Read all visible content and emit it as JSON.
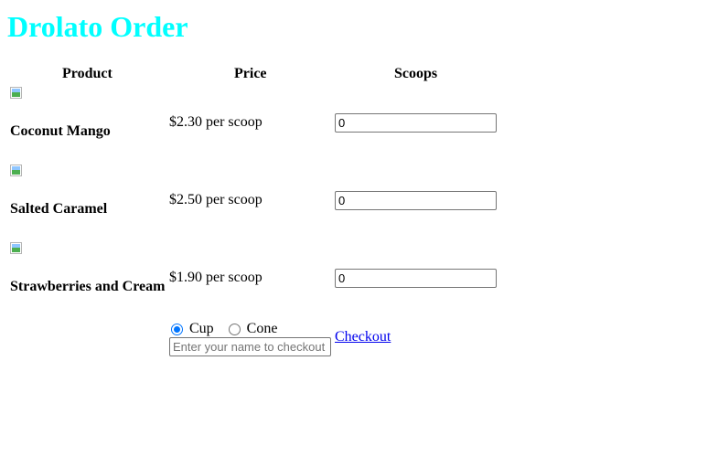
{
  "title": "Drolato Order",
  "table_headers": {
    "product": "Product",
    "price": "Price",
    "scoops": "Scoops"
  },
  "products": [
    {
      "name": "Coconut Mango",
      "price": "$2.30 per scoop",
      "scoops": "0"
    },
    {
      "name": "Salted Caramel",
      "price": "$2.50 per scoop",
      "scoops": "0"
    },
    {
      "name": "Strawberries and Cream",
      "price": "$1.90 per scoop",
      "scoops": "0"
    }
  ],
  "serving": {
    "options": [
      "Cup",
      "Cone"
    ],
    "selected": "Cup"
  },
  "name_input": {
    "placeholder": "Enter your name to checkout",
    "value": ""
  },
  "checkout_label": "Checkout",
  "colors": {
    "title": "#00ffff",
    "link": "#0000ee",
    "radio_accent": "#0075ff"
  },
  "icons": {
    "product_image": "broken-image-icon"
  }
}
